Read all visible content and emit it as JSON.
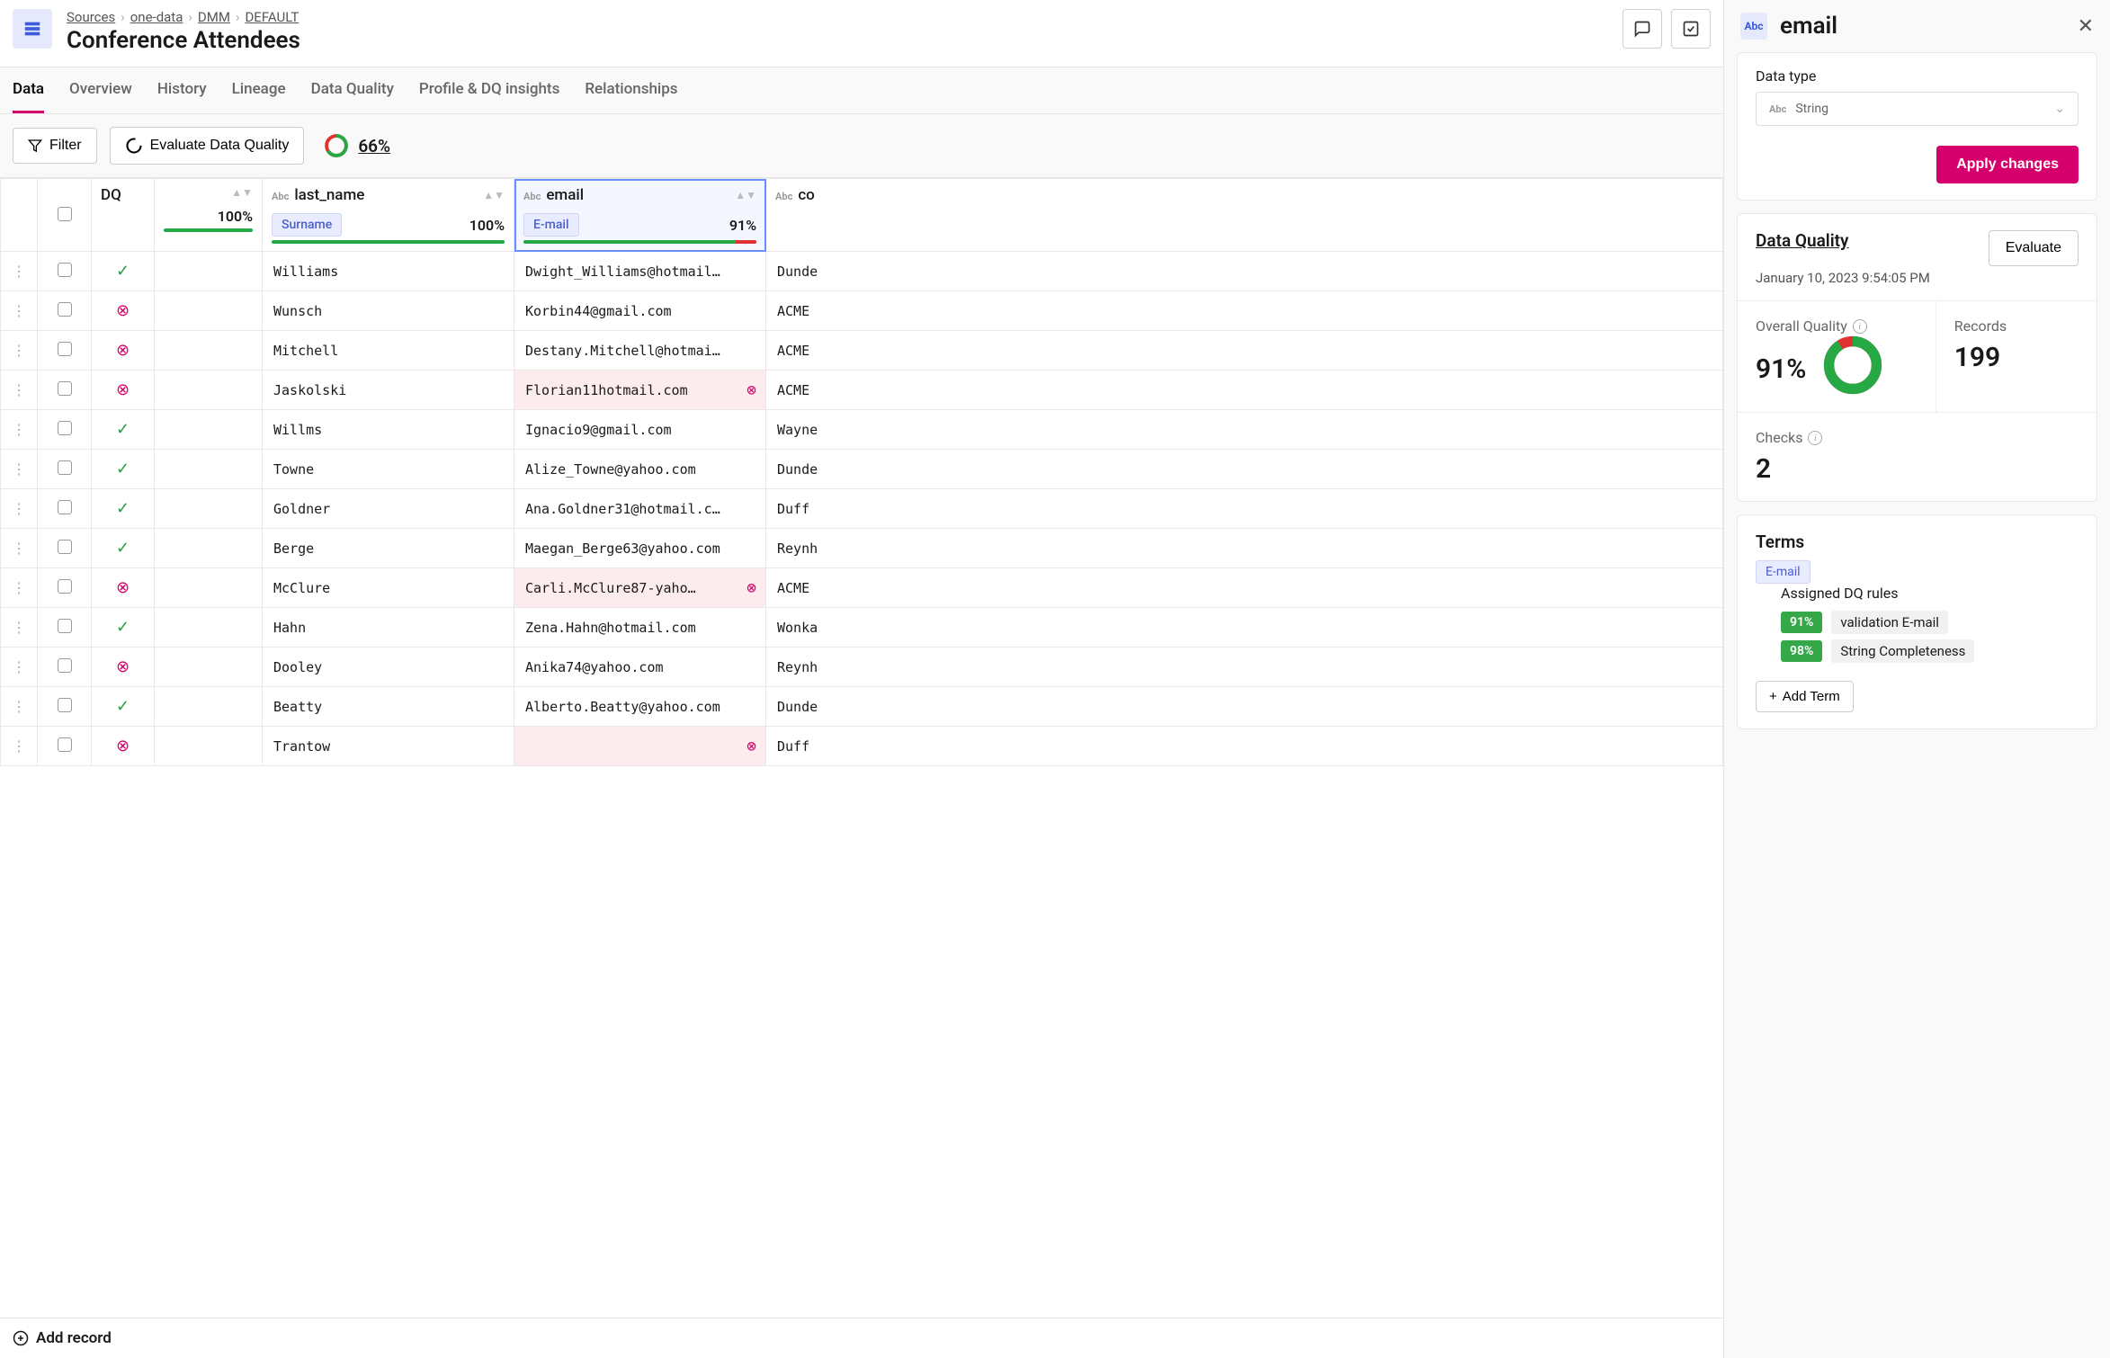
{
  "breadcrumb": [
    "Sources",
    "one-data",
    "DMM",
    "DEFAULT"
  ],
  "page_title": "Conference Attendees",
  "tabs": [
    "Data",
    "Overview",
    "History",
    "Lineage",
    "Data Quality",
    "Profile & DQ insights",
    "Relationships"
  ],
  "active_tab": "Data",
  "toolbar": {
    "filter_label": "Filter",
    "evaluate_label": "Evaluate Data Quality",
    "overall_pct": "66%"
  },
  "columns": {
    "dq_header": "DQ",
    "blank_pct": "100%",
    "last_name": {
      "type": "Abc",
      "name": "last_name",
      "term": "Surname",
      "pct": "100%"
    },
    "email": {
      "type": "Abc",
      "name": "email",
      "term": "E-mail",
      "pct": "91%"
    },
    "company": {
      "type": "Abc",
      "name": "co"
    }
  },
  "rows": [
    {
      "dq": "ok",
      "last_name": "Williams",
      "email": "Dwight_Williams@hotmail…",
      "email_err": false,
      "company": "Dunde"
    },
    {
      "dq": "bad",
      "last_name": "Wunsch",
      "email": "Korbin44@gmail.com",
      "email_err": false,
      "company": "ACME"
    },
    {
      "dq": "bad",
      "last_name": "Mitchell",
      "email": "Destany.Mitchell@hotmai…",
      "email_err": false,
      "company": "ACME"
    },
    {
      "dq": "bad",
      "last_name": "Jaskolski",
      "email": "Florian11hotmail.com",
      "email_err": true,
      "company": "ACME"
    },
    {
      "dq": "ok",
      "last_name": "Willms",
      "email": "Ignacio9@gmail.com",
      "email_err": false,
      "company": "Wayne"
    },
    {
      "dq": "ok",
      "last_name": "Towne",
      "email": "Alize_Towne@yahoo.com",
      "email_err": false,
      "company": "Dunde"
    },
    {
      "dq": "ok",
      "last_name": "Goldner",
      "email": "Ana.Goldner31@hotmail.c…",
      "email_err": false,
      "company": "Duff"
    },
    {
      "dq": "ok",
      "last_name": "Berge",
      "email": "Maegan_Berge63@yahoo.com",
      "email_err": false,
      "company": "Reynh"
    },
    {
      "dq": "bad",
      "last_name": "McClure",
      "email": "Carli.McClure87-yaho…",
      "email_err": true,
      "company": "ACME"
    },
    {
      "dq": "ok",
      "last_name": "Hahn",
      "email": "Zena.Hahn@hotmail.com",
      "email_err": false,
      "company": "Wonka"
    },
    {
      "dq": "bad",
      "last_name": "Dooley",
      "email": "Anika74@yahoo.com",
      "email_err": false,
      "company": "Reynh"
    },
    {
      "dq": "ok",
      "last_name": "Beatty",
      "email": "Alberto.Beatty@yahoo.com",
      "email_err": false,
      "company": "Dunde"
    },
    {
      "dq": "bad",
      "last_name": "Trantow",
      "email": "",
      "email_err": true,
      "company": "Duff"
    }
  ],
  "add_record": "Add record",
  "panel": {
    "title": "email",
    "data_type_label": "Data type",
    "data_type_value": "String",
    "apply_label": "Apply changes",
    "dq_heading": "Data Quality",
    "dq_time": "January 10, 2023 9:54:05 PM",
    "evaluate_btn": "Evaluate",
    "overall_label": "Overall Quality",
    "overall_value": "91%",
    "records_label": "Records",
    "records_value": "199",
    "checks_label": "Checks",
    "checks_value": "2",
    "terms_heading": "Terms",
    "term_badge": "E-mail",
    "rules_heading": "Assigned DQ rules",
    "rules": [
      {
        "pct": "91%",
        "name": "validation E-mail"
      },
      {
        "pct": "98%",
        "name": "String Completeness"
      }
    ],
    "add_term": "Add Term"
  }
}
